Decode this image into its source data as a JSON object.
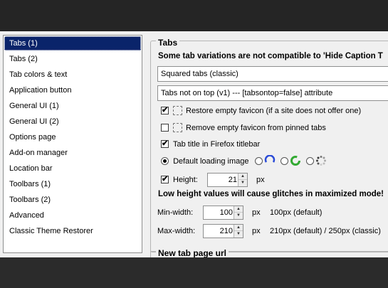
{
  "sidebar": {
    "items": [
      {
        "label": "Tabs (1)",
        "selected": true
      },
      {
        "label": "Tabs (2)"
      },
      {
        "label": "Tab colors & text"
      },
      {
        "label": "Application button"
      },
      {
        "label": "General UI (1)"
      },
      {
        "label": "General UI (2)"
      },
      {
        "label": "Options page"
      },
      {
        "label": "Add-on manager"
      },
      {
        "label": "Location bar"
      },
      {
        "label": "Toolbars (1)"
      },
      {
        "label": "Toolbars (2)"
      },
      {
        "label": "Advanced"
      },
      {
        "label": "Classic Theme Restorer"
      }
    ]
  },
  "tabs_group": {
    "title": "Tabs",
    "warning": "Some tab variations are not compatible to 'Hide Caption T",
    "tab_style_select": "Squared tabs (classic)",
    "tab_position_select": "Tabs not on top (v1) --- [tabsontop=false] attribute",
    "restore_empty_favicon": {
      "label": "Restore empty favicon (if a site does not offer one)",
      "checked": true
    },
    "remove_empty_favicon": {
      "label": "Remove empty favicon from pinned tabs",
      "checked": false
    },
    "tab_title_in_titlebar": {
      "label": "Tab title in Firefox titlebar",
      "checked": true
    },
    "loading_image": {
      "label": "Default loading image",
      "selected_option": 0
    },
    "height": {
      "label": "Height:",
      "checked": true,
      "value": "21",
      "unit": "px"
    },
    "height_warning": "Low height values will cause glitches in maximized mode!",
    "min_width": {
      "label": "Min-width:",
      "value": "100",
      "unit": "px",
      "hint": "100px (default)"
    },
    "max_width": {
      "label": "Max-width:",
      "value": "210",
      "unit": "px",
      "hint": "210px (default) / 250px (classic)"
    }
  },
  "new_tab_group": {
    "title": "New tab page url"
  },
  "check_mark": "✔",
  "spin_up": "▲",
  "spin_down": "▼",
  "colors": {
    "selection": "#0a246a",
    "throbber_blue": "#2a4bd7",
    "throbber_green": "#33aa33",
    "background_dark": "#2a2a2a"
  }
}
